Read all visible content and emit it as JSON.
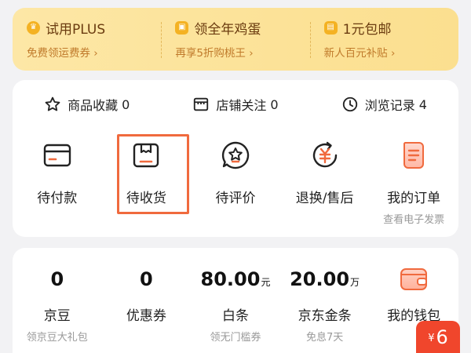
{
  "promo": [
    {
      "title": "试用PLUS",
      "subtitle": "免费领运费券 ›",
      "icon": "crown-icon"
    },
    {
      "title": "领全年鸡蛋",
      "subtitle": "再享5折购桃王 ›",
      "icon": "gift-icon"
    },
    {
      "title": "1元包邮",
      "subtitle": "新人百元补贴 ›",
      "icon": "coupon-icon"
    }
  ],
  "stats": [
    {
      "label": "商品收藏",
      "count": "0",
      "icon": "star-icon"
    },
    {
      "label": "店铺关注",
      "count": "0",
      "icon": "store-icon"
    },
    {
      "label": "浏览记录",
      "count": "4",
      "icon": "clock-icon"
    }
  ],
  "orders": [
    {
      "label": "待付款",
      "icon": "card-icon"
    },
    {
      "label": "待收货",
      "icon": "package-icon"
    },
    {
      "label": "待评价",
      "icon": "review-icon"
    },
    {
      "label": "退换/售后",
      "icon": "refund-icon"
    },
    {
      "label": "我的订单",
      "sub": "查看电子发票",
      "icon": "receipt-icon"
    }
  ],
  "wallet": [
    {
      "value": "0",
      "unit": "",
      "label": "京豆",
      "sub": "领京豆大礼包"
    },
    {
      "value": "0",
      "unit": "",
      "label": "优惠券",
      "sub": ""
    },
    {
      "value": "80.00",
      "unit": "元",
      "label": "白条",
      "sub": "领无门槛券"
    },
    {
      "value": "20.00",
      "unit": "万",
      "label": "京东金条",
      "sub": "免息7天"
    },
    {
      "value": "",
      "unit": "",
      "label": "我的钱包",
      "sub": "",
      "icon": "wallet-icon"
    }
  ],
  "float_badge": {
    "symbol": "¥",
    "value": "6"
  },
  "colors": {
    "accent": "#f0462c",
    "highlight": "#f06a3e",
    "promo_text": "#6b3c10",
    "promo_sub": "#c07a2b"
  }
}
